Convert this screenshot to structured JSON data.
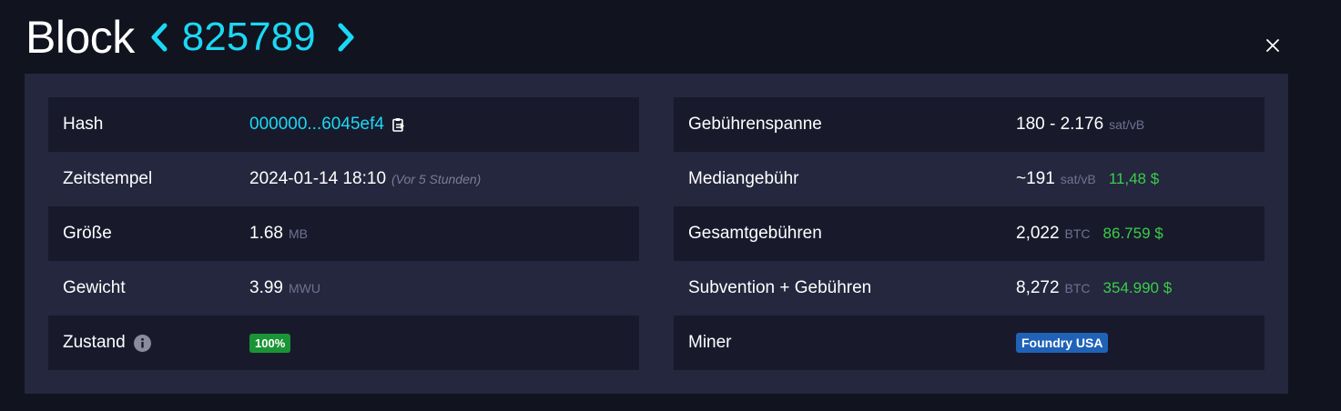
{
  "header": {
    "title": "Block",
    "block_number": "825789",
    "prev_icon": "chevron-left-icon",
    "next_icon": "chevron-right-icon",
    "close_icon": "close-icon",
    "accent_color": "#1bd8f4"
  },
  "left_table": {
    "hash": {
      "label": "Hash",
      "value": "000000...6045ef4",
      "copy_icon": "clipboard-icon"
    },
    "timestamp": {
      "label": "Zeitstempel",
      "value": "2024-01-14 18:10",
      "relative": "(Vor 5 Stunden)"
    },
    "size": {
      "label": "Größe",
      "value": "1.68",
      "unit": "MB"
    },
    "weight": {
      "label": "Gewicht",
      "value": "3.99",
      "unit": "MWU"
    },
    "health": {
      "label": "Zustand",
      "info_icon": "info-icon",
      "badge": "100%",
      "badge_color": "#1a9436"
    }
  },
  "right_table": {
    "fee_span": {
      "label": "Gebührenspanne",
      "value": "180 - 2.176",
      "unit": "sat/vB"
    },
    "median_fee": {
      "label": "Mediangebühr",
      "value": "~191",
      "unit": "sat/vB",
      "usd": "11,48 $"
    },
    "total_fees": {
      "label": "Gesamtgebühren",
      "value": "2,022",
      "unit": "BTC",
      "usd": "86.759 $"
    },
    "subsidy_fees": {
      "label": "Subvention + Gebühren",
      "value": "8,272",
      "unit": "BTC",
      "usd": "354.990 $"
    },
    "miner": {
      "label": "Miner",
      "badge": "Foundry USA",
      "badge_color": "#1f62b8"
    }
  },
  "colors": {
    "background": "#11131f",
    "panel": "#24273e",
    "row_dark": "#181a2c",
    "usd_green": "#3bcc49"
  }
}
